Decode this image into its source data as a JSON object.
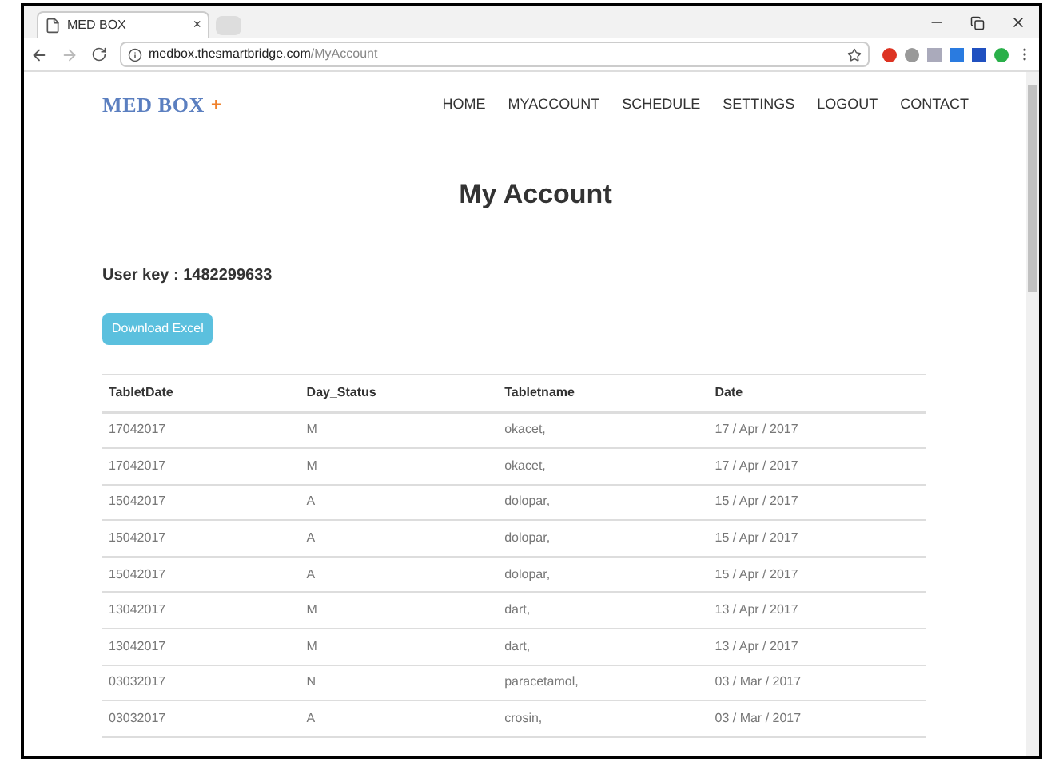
{
  "browser": {
    "tab_title": "MED BOX",
    "tab_close": "×",
    "url_host": "medbox.thesmartbridge.com",
    "url_path": "/MyAccount"
  },
  "site": {
    "logo": "MED BOX",
    "logo_mark": "+",
    "nav": [
      {
        "label": "HOME"
      },
      {
        "label": "MYACCOUNT"
      },
      {
        "label": "SCHEDULE"
      },
      {
        "label": "SETTINGS"
      },
      {
        "label": "LOGOUT"
      },
      {
        "label": "CONTACT"
      }
    ]
  },
  "page": {
    "title": "My Account",
    "user_key": "User key : 1482299633",
    "download_button": "Download Excel"
  },
  "table": {
    "columns": [
      "TabletDate",
      "Day_Status",
      "Tabletname",
      "Date"
    ],
    "rows": [
      [
        "17042017",
        "M",
        "okacet,",
        "17 / Apr / 2017"
      ],
      [
        "17042017",
        "M",
        "okacet,",
        "17 / Apr / 2017"
      ],
      [
        "15042017",
        "A",
        "dolopar,",
        "15 / Apr / 2017"
      ],
      [
        "15042017",
        "A",
        "dolopar,",
        "15 / Apr / 2017"
      ],
      [
        "15042017",
        "A",
        "dolopar,",
        "15 / Apr / 2017"
      ],
      [
        "13042017",
        "M",
        "dart,",
        "13 / Apr / 2017"
      ],
      [
        "13042017",
        "M",
        "dart,",
        "13 / Apr / 2017"
      ],
      [
        "03032017",
        "N",
        "paracetamol,",
        "03 / Mar / 2017"
      ],
      [
        "03032017",
        "A",
        "crosin,",
        "03 / Mar / 2017"
      ]
    ]
  }
}
